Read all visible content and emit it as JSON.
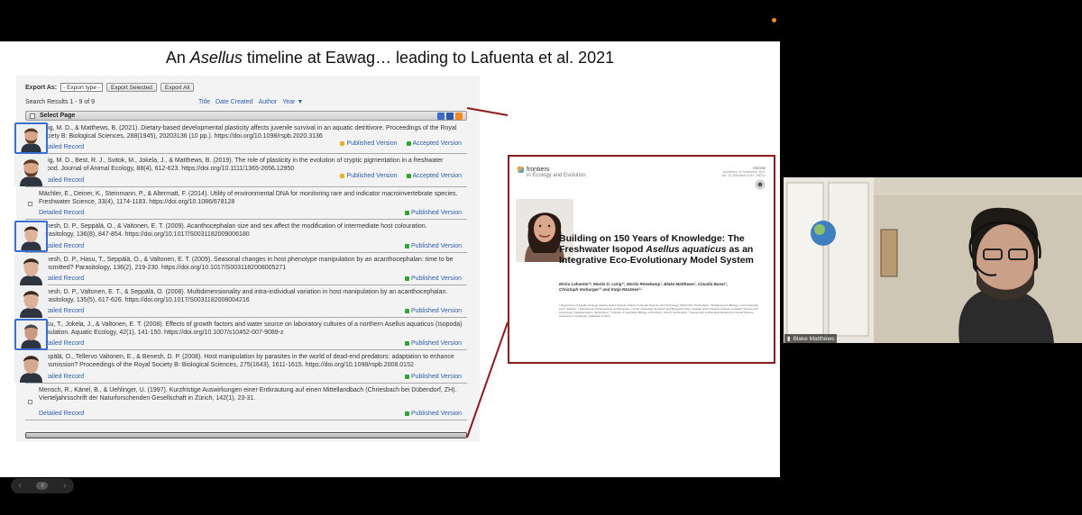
{
  "slide": {
    "title_pre": "An ",
    "title_em": "Asellus",
    "title_post": " timeline at Eawag… leading to Lafuenta et al. 2021"
  },
  "repo": {
    "export_label": "Export As:",
    "export_select": "- Export type -",
    "export_selected": "Export Selected",
    "export_all": "Export All",
    "search_results": "Search Results 1 - 9 of 9",
    "sort": [
      "Title",
      "Date Created",
      "Author",
      "Year ▼"
    ],
    "select_page": "Select Page",
    "detailed_record": "Detailed Record",
    "published_version": "Published Version",
    "accepted_version": "Accepted Version",
    "records": [
      {
        "citation": "Lürig, M. D., & Matthews, B. (2021). Dietary-based developmental plasticity affects juvenile survival in an aquatic detritivore. Proceedings of the Royal Society B: Biological Sciences, 288(1945), 20203136 (10 pp.). https://doi.org/10.1098/rspb.2020.3136",
        "accepted": true
      },
      {
        "citation": "Lürig, M. D., Best, R. J., Svitok, M., Jokela, J., & Matthews, B. (2019). The role of plasticity in the evolution of cryptic pigmentation in a freshwater isopod. Journal of Animal Ecology, 88(4), 612-623. https://doi.org/10.1111/1365-2656.12950",
        "accepted": true
      },
      {
        "citation": "Mächler, E., Deiner, K., Steinmann, P., & Altermatt, F. (2014). Utility of environmental DNA for monitoring rare and indicator macroinvertebrate species. Freshwater Science, 33(4), 1174-1183. https://doi.org/10.1086/678128",
        "accepted": false
      },
      {
        "citation": "Benesh, D. P., Seppälä, O., & Valtonen, E. T. (2009). Acanthocephalan size and sex affect the modification of intermediate host colouration. Parasitology, 136(8), 847-854. https://doi.org/10.1017/S0031182009006180",
        "accepted": false
      },
      {
        "citation": "Benesh, D. P., Hasu, T., Seppälä, O., & Valtonen, E. T. (2009). Seasonal changes in host phenotype manipulation by an acanthocephalan: time to be transmitted? Parasitology, 136(2), 219-230. https://doi.org/10.1017/S0031182008005271",
        "accepted": false
      },
      {
        "citation": "Benesh, D. P., Valtonen, E. T., & Seppälä, O. (2008). Multidimensionality and intra-individual variation in host manipulation by an acanthocephalan. Parasitology, 135(5), 617-626. https://doi.org/10.1017/S0031182008004216",
        "accepted": false
      },
      {
        "citation": "Hasu, T., Jokela, J., & Valtonen, E. T. (2008). Effects of growth factors and water source on laboratory cultures of a northern Asellus aquaticus (Isopoda) population. Aquatic Ecology, 42(1), 141-150. https://doi.org/10.1007/s10452-007-9089-z",
        "accepted": false
      },
      {
        "citation": "Seppälä, O., Tellervo Valtonen, E., & Benesh, D. P. (2008). Host manipulation by parasites in the world of dead-end predators: adaptation to enhance transmission? Proceedings of the Royal Society B: Biological Sciences, 275(1643), 1611-1615. https://doi.org/10.1098/rspb.2008.0152",
        "accepted": false
      },
      {
        "citation": "Mensch, R., Känel, B., & Uehlinger, U. (1997). Kurzfristige Auswirkungen einer Entkrautung auf einen Mittellandbach (Chriesbach bei Dübendorf, ZH). Vierteljahrsschrift der Naturforschenden Gesellschaft in Zürich, 142(1), 23-31.",
        "accepted": false
      }
    ]
  },
  "paper": {
    "journal_name": "frontiers",
    "journal_sub": "in Ecology and Evolution",
    "review": "REVIEW",
    "published": "published: 04 November 2021",
    "doi": "doi: 10.3389/fevo.2021.748212",
    "title_a": "Building on 150 Years of Knowledge: The Freshwater Isopod ",
    "title_em": "Asellus aquaticus",
    "title_b": " as an Integrative Eco-Evolutionary Model System",
    "authors": "Elvira Lafuente¹*, Moritz D. Lürig¹², Moritz Rövekamp¹, Blake Matthews¹, Claudia Buser¹, Christoph Vorburger¹³ and Katja Räsänen¹⁴",
    "affiliations": "¹ Department of Aquatic Ecology, Eawag: Swiss Federal Institute of Aquatic Science and Technology, Dübendorf, Switzerland, ² Department of Biology, Lund University, Lund, Sweden, ³ Department of Fish Ecology and Evolution, Center of Ecology, Evolution and Biogeochemistry, Eawag: Swiss Federal Institute of Aquatic Science and Technology, Kastanienbaum, Switzerland, ⁴ Institute of Integrative Biology, ETH Zürich, Zürich, Switzerland, ⁵ Department of Biological and Environmental Science, University of Jyväskylä, Jyväskylä, Finland"
  },
  "participant": {
    "name": "Blake Matthews"
  },
  "pager": {
    "prev": "‹",
    "page": "0",
    "next": "›"
  },
  "colors": {
    "link": "#2b5ea8",
    "frame": "#8b1c1c",
    "highlight": "#3a6fd1",
    "lock_green": "#2fa52f",
    "lock_yellow": "#e2b22a"
  }
}
